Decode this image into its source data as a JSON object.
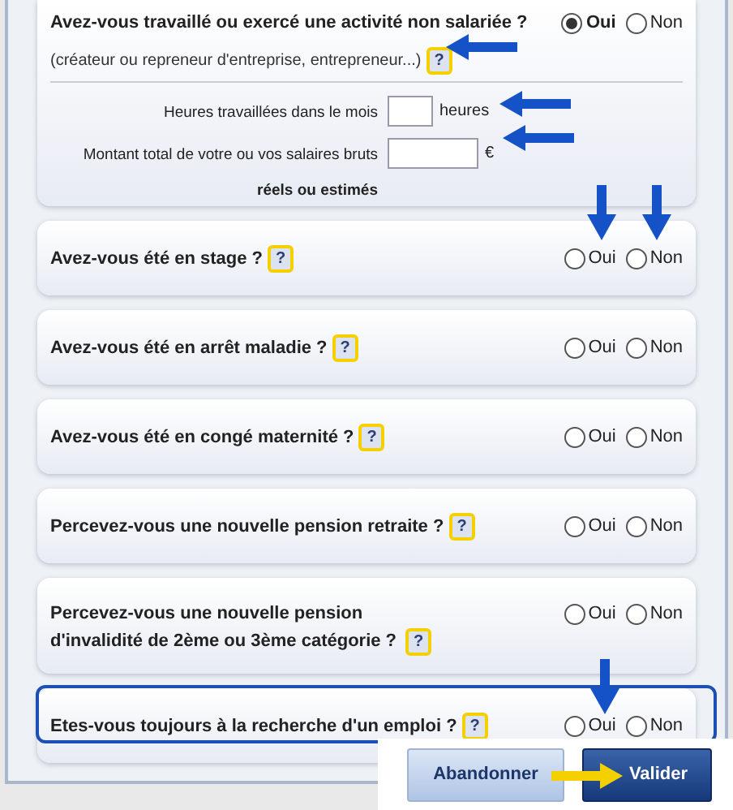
{
  "activity": {
    "question": "Avez-vous travaillé ou exercé une activité non salariée ?",
    "note": "(créateur ou repreneur d'entreprise, entrepreneur...)",
    "help": "?",
    "options": [
      {
        "label": "Oui",
        "selected": true
      },
      {
        "label": "Non",
        "selected": false
      }
    ],
    "fields": [
      {
        "label": "Heures travaillées dans le mois",
        "unit": "heures",
        "kind": "short"
      },
      {
        "label": "Montant total de votre ou vos salaires bruts **réels** **ou estimés**",
        "unit": "€",
        "kind": "long"
      }
    ]
  },
  "questions": [
    {
      "question": "Avez-vous été en stage ?",
      "help": "?",
      "highlighted": false,
      "options": [
        {
          "label": "Oui",
          "selected": false
        },
        {
          "label": "Non",
          "selected": false
        }
      ]
    },
    {
      "question": "Avez-vous été en arrêt maladie ?",
      "help": "?",
      "highlighted": false,
      "options": [
        {
          "label": "Oui",
          "selected": false
        },
        {
          "label": "Non",
          "selected": false
        }
      ]
    },
    {
      "question": "Avez-vous été en congé maternité ?",
      "help": "?",
      "highlighted": false,
      "options": [
        {
          "label": "Oui",
          "selected": false
        },
        {
          "label": "Non",
          "selected": false
        }
      ]
    },
    {
      "question": "Percevez-vous une nouvelle pension retraite ?",
      "help": "?",
      "highlighted": false,
      "options": [
        {
          "label": "Oui",
          "selected": false
        },
        {
          "label": "Non",
          "selected": false
        }
      ]
    },
    {
      "question": "Percevez-vous une nouvelle pension d'invalidité de 2ème ou 3ème catégorie ?",
      "help": "?",
      "highlighted": false,
      "options": [
        {
          "label": "Oui",
          "selected": false
        },
        {
          "label": "Non",
          "selected": false
        }
      ]
    },
    {
      "question": "Etes-vous toujours à la recherche d'un emploi ?",
      "help": "?",
      "highlighted": true,
      "options": [
        {
          "label": "Oui",
          "selected": false
        },
        {
          "label": "Non",
          "selected": false
        }
      ]
    }
  ],
  "buttons": [
    {
      "label": "Abandonner",
      "kind": "secondary"
    },
    {
      "label": "Valider",
      "kind": "primary"
    }
  ]
}
